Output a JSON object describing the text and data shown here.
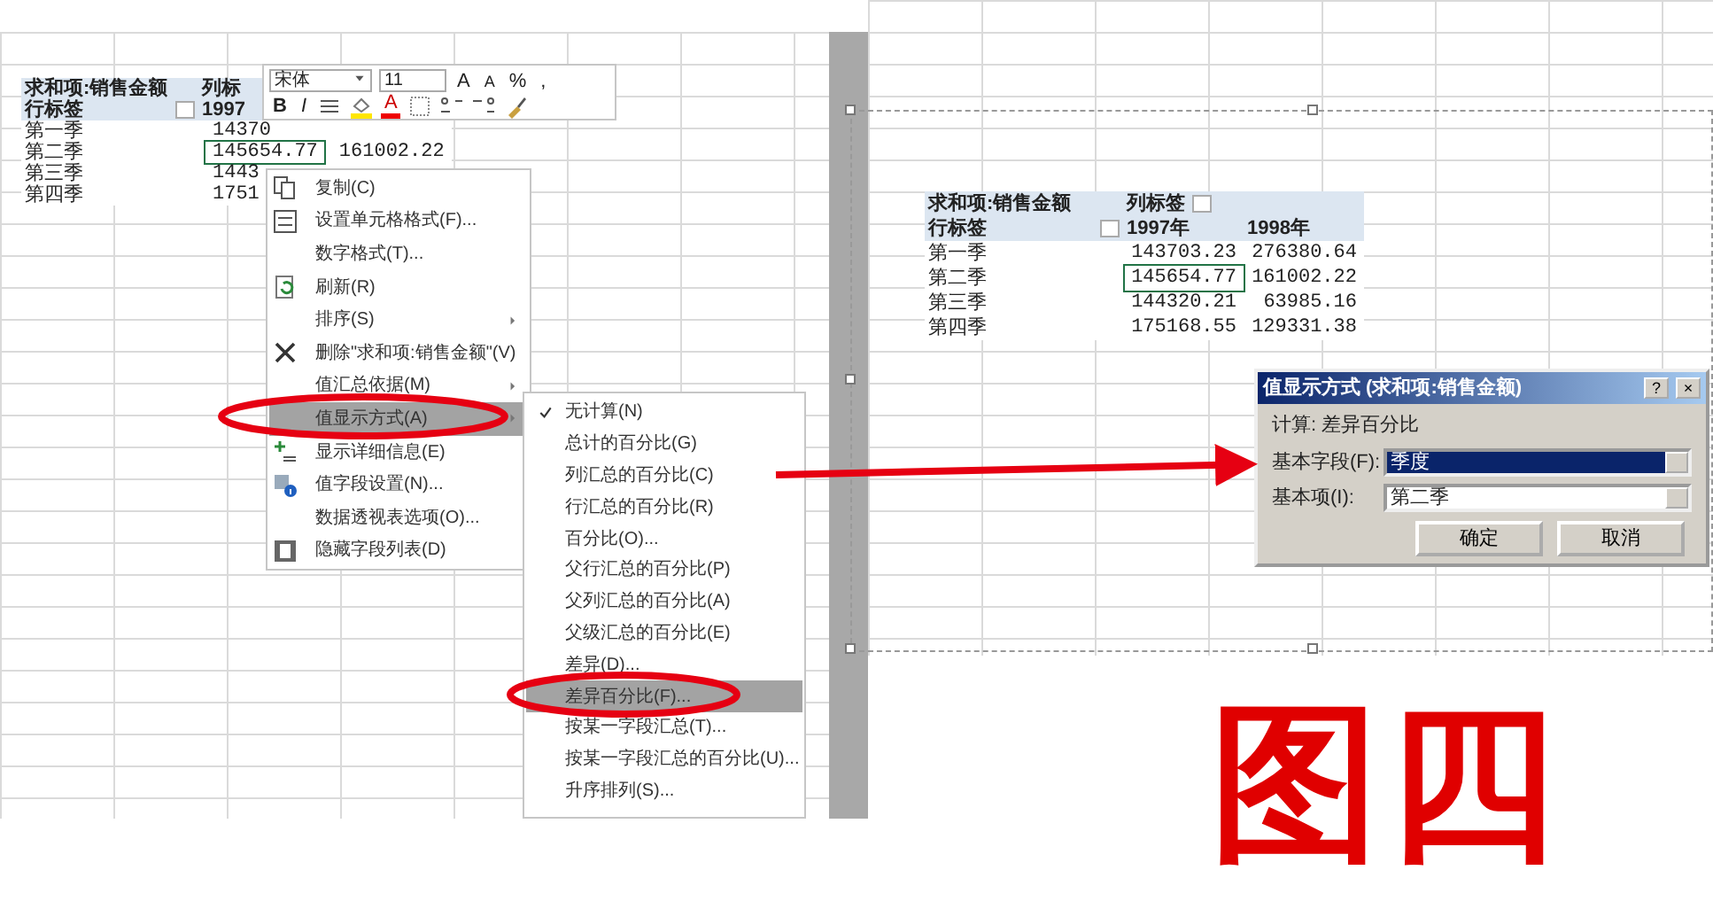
{
  "left_sheet": {
    "pivot": {
      "title": "求和项:销售金额",
      "column_label": "列标",
      "row_label": "行标签",
      "years": [
        "1997"
      ],
      "rows": [
        {
          "label": "第一季",
          "values": [
            "14370"
          ],
          "selected": false
        },
        {
          "label": "第二季",
          "values": [
            "145654.77",
            "161002.22"
          ],
          "selected": true
        },
        {
          "label": "第三季",
          "values": [
            "1443"
          ],
          "selected": false
        },
        {
          "label": "第四季",
          "values": [
            "1751"
          ],
          "selected": false
        }
      ]
    }
  },
  "mini_toolbar": {
    "font": "宋体",
    "size": "11",
    "grow_font": "A",
    "shrink_font": "A",
    "percent": "%",
    "comma": ",",
    "bold": "B",
    "italic": "I",
    "font_color": "A"
  },
  "context_menu": {
    "items": [
      {
        "label": "复制(C)",
        "kind": "copy",
        "submenu": false,
        "selected": false
      },
      {
        "label": "设置单元格格式(F)...",
        "kind": "format",
        "submenu": false,
        "selected": false
      },
      {
        "label": "数字格式(T)...",
        "kind": "plain",
        "submenu": false,
        "selected": false
      },
      {
        "label": "刷新(R)",
        "kind": "refresh",
        "submenu": false,
        "selected": false
      },
      {
        "label": "排序(S)",
        "kind": "plain",
        "submenu": true,
        "selected": false
      },
      {
        "label": "删除\"求和项:销售金额\"(V)",
        "kind": "delete",
        "submenu": false,
        "selected": false
      },
      {
        "label": "值汇总依据(M)",
        "kind": "plain",
        "submenu": true,
        "selected": false
      },
      {
        "label": "值显示方式(A)",
        "kind": "plain",
        "submenu": true,
        "selected": true
      },
      {
        "label": "显示详细信息(E)",
        "kind": "details",
        "submenu": false,
        "selected": false
      },
      {
        "label": "值字段设置(N)...",
        "kind": "settings",
        "submenu": false,
        "selected": false
      },
      {
        "label": "数据透视表选项(O)...",
        "kind": "plain",
        "submenu": false,
        "selected": false
      },
      {
        "label": "隐藏字段列表(D)",
        "kind": "list",
        "submenu": false,
        "selected": false
      }
    ]
  },
  "submenu": {
    "items": [
      {
        "label": "无计算(N)",
        "checked": true,
        "selected": false
      },
      {
        "label": "总计的百分比(G)",
        "checked": false,
        "selected": false
      },
      {
        "label": "列汇总的百分比(C)",
        "checked": false,
        "selected": false
      },
      {
        "label": "行汇总的百分比(R)",
        "checked": false,
        "selected": false
      },
      {
        "label": "百分比(O)...",
        "checked": false,
        "selected": false
      },
      {
        "label": "父行汇总的百分比(P)",
        "checked": false,
        "selected": false
      },
      {
        "label": "父列汇总的百分比(A)",
        "checked": false,
        "selected": false
      },
      {
        "label": "父级汇总的百分比(E)",
        "checked": false,
        "selected": false
      },
      {
        "label": "差异(D)...",
        "checked": false,
        "selected": false
      },
      {
        "label": "差异百分比(F)...",
        "checked": false,
        "selected": true
      },
      {
        "label": "按某一字段汇总(T)...",
        "checked": false,
        "selected": false
      },
      {
        "label": "按某一字段汇总的百分比(U)...",
        "checked": false,
        "selected": false
      },
      {
        "label": "升序排列(S)...",
        "checked": false,
        "selected": false
      }
    ]
  },
  "right_sheet": {
    "pivot": {
      "title": "求和项:销售金额",
      "column_label": "列标签",
      "row_label": "行标签",
      "years": [
        "1997年",
        "1998年"
      ],
      "rows": [
        {
          "label": "第一季",
          "values": [
            "143703.23",
            "276380.64"
          ],
          "selected": false
        },
        {
          "label": "第二季",
          "values": [
            "145654.77",
            "161002.22"
          ],
          "selected": true
        },
        {
          "label": "第三季",
          "values": [
            "144320.21",
            "63985.16"
          ],
          "selected": false
        },
        {
          "label": "第四季",
          "values": [
            "175168.55",
            "129331.38"
          ],
          "selected": false
        }
      ]
    }
  },
  "dialog": {
    "title": "值显示方式 (求和项:销售金额)",
    "help": "?",
    "close": "×",
    "calculation": "计算: 差异百分比",
    "fields": [
      {
        "label": "基本字段(F):",
        "value": "季度",
        "selected": true
      },
      {
        "label": "基本项(I):",
        "value": "第二季",
        "selected": false
      }
    ],
    "buttons": [
      "确定",
      "取消"
    ]
  },
  "caption": "图四"
}
